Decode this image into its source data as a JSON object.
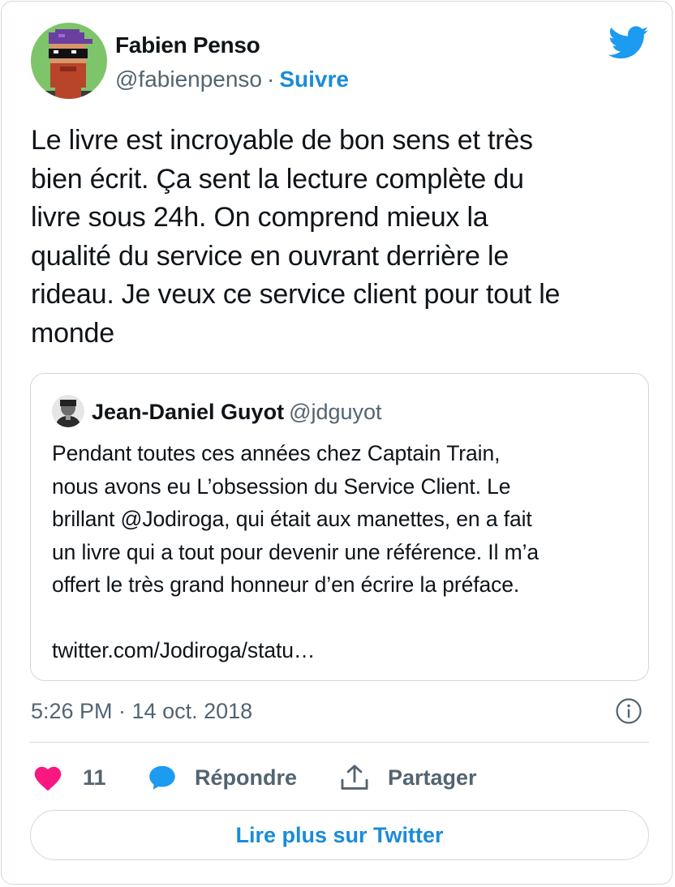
{
  "author": {
    "name": "Fabien Penso",
    "handle": "@fabienpenso",
    "separator": "·",
    "follow_label": "Suivre"
  },
  "tweet": {
    "text": "Le livre est incroyable de bon sens et très\nbien écrit. Ça sent la lecture complète du\nlivre sous 24h. On comprend mieux la\nqualité du service en ouvrant derrière le\nrideau. Je veux ce service client pour tout le\nmonde",
    "timestamp": "5:26 PM · 14 oct. 2018"
  },
  "quoted": {
    "name": "Jean-Daniel Guyot",
    "handle": "@jdguyot",
    "text": "Pendant toutes ces années chez Captain Train,\nnous avons eu L’obsession du Service Client. Le\nbrillant @Jodiroga, qui était aux manettes, en a fait\nun livre qui a tout pour devenir une référence. Il m’a\noffert le très grand honneur d’en écrire la préface.\n\ntwitter.com/Jodiroga/statu…"
  },
  "actions": {
    "like_count": "11",
    "reply_label": "Répondre",
    "share_label": "Partager"
  },
  "read_more_label": "Lire plus sur Twitter",
  "colors": {
    "brand_blue": "#1d9bf0",
    "link_blue": "#1a8cd8",
    "heart_pink": "#f91880",
    "muted_gray": "#536471",
    "border": "#cfd9de"
  },
  "icons": {
    "logo": "twitter-bird-icon",
    "info": "info-icon",
    "like": "heart-icon",
    "reply": "speech-bubble-icon",
    "share": "share-upload-icon"
  }
}
